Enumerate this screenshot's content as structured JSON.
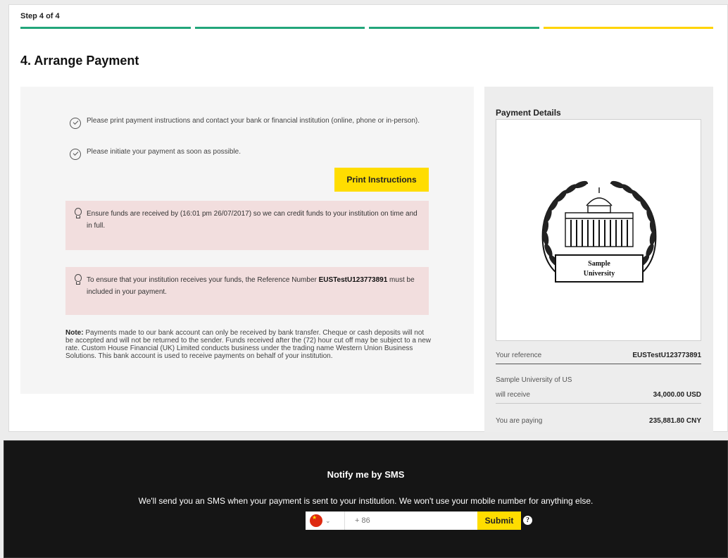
{
  "header": {
    "step_label": "Step 4 of 4",
    "progress_colors": [
      "#22a67a",
      "#22a67a",
      "#22a67a",
      "#ffd400"
    ],
    "title": "4. Arrange Payment"
  },
  "instructions": {
    "items": [
      "Please print payment instructions and contact your bank or financial institution (online, phone or in-person).",
      "Please initiate your payment as soon as possible."
    ],
    "print_button": "Print Instructions"
  },
  "notices": {
    "funds": "Ensure funds are received by (16:01 pm 26/07/2017) so we can credit funds to your institution on time and in full.",
    "reference_prefix": "To ensure that your institution receives your funds, the Reference Number ",
    "reference_number": "EUSTestU123773891",
    "reference_suffix": " must be included in your payment."
  },
  "note": {
    "label": "Note:",
    "text": " Payments made to our bank account can only be received by bank transfer. Cheque or cash deposits will not be accepted and will not be returned to the sender. Funds received after the (72) hour cut off may be subject to a new rate. Custom House Financial (UK) Limited conducts business under the trading name Western Union Business Solutions. This bank account is used to receive payments on behalf of your institution."
  },
  "payment_details": {
    "title": "Payment Details",
    "logo_text_line1": "Sample",
    "logo_text_line2": "University",
    "reference_label": "Your reference",
    "reference_value": "EUSTestU123773891",
    "institution_name": "Sample University of US",
    "receive_label": "will receive",
    "receive_value": "34,000.00 USD",
    "paying_label": "You are paying",
    "paying_value": "235,881.80 CNY"
  },
  "sms": {
    "title": "Notify me by SMS",
    "description": "We'll send you an SMS when your payment is sent to your institution. We won't use your mobile number for anything else.",
    "country_flag": "china-flag-icon",
    "phone_placeholder": "+ 86",
    "submit_label": "Submit",
    "info_symbol": "?"
  },
  "colors": {
    "accent_yellow": "#ffdd00",
    "progress_green": "#22a67a",
    "notice_bg": "#f2dede"
  }
}
